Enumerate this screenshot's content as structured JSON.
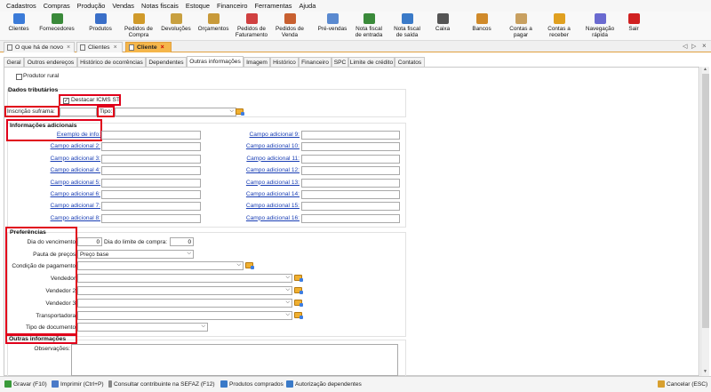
{
  "menu": [
    "Cadastros",
    "Compras",
    "Produção",
    "Vendas",
    "Notas fiscais",
    "Estoque",
    "Financeiro",
    "Ferramentas",
    "Ajuda"
  ],
  "toolbar": [
    {
      "label": "Clientes",
      "icon": "clientes-icon",
      "color": "#3b7bd8"
    },
    {
      "label": "Fornecedores",
      "icon": "fornecedores-icon",
      "color": "#3a8a3a"
    },
    {
      "label": "Produtos",
      "icon": "produtos-icon",
      "color": "#3a6fc8"
    },
    {
      "label": "Pedidos de\nCompra",
      "icon": "pedidos-compra-icon",
      "color": "#d09a2a"
    },
    {
      "label": "Devoluções",
      "icon": "devolucoes-icon",
      "color": "#c8a040"
    },
    {
      "label": "Orçamentos",
      "icon": "orcamentos-icon",
      "color": "#c89a3a"
    },
    {
      "label": "Pedidos de\nFaturamento",
      "icon": "pedidos-faturamento-icon",
      "color": "#d04040"
    },
    {
      "label": "Pedidos de\nVenda",
      "icon": "pedidos-venda-icon",
      "color": "#c86030"
    },
    {
      "label": "Pré-vendas",
      "icon": "pre-vendas-icon",
      "color": "#5a8ad0"
    },
    {
      "label": "Nota fiscal\nde entrada",
      "icon": "nota-entrada-icon",
      "color": "#3a8a3a"
    },
    {
      "label": "Nota fiscal\nde saída",
      "icon": "nota-saida-icon",
      "color": "#3a7ac8"
    },
    {
      "label": "Caixa",
      "icon": "caixa-icon",
      "color": "#555555"
    },
    {
      "label": "Bancos",
      "icon": "bancos-icon",
      "color": "#d08a2a"
    },
    {
      "label": "Contas a\npagar",
      "icon": "contas-pagar-icon",
      "color": "#c8a060"
    },
    {
      "label": "Contas a\nreceber",
      "icon": "contas-receber-icon",
      "color": "#e0a020"
    },
    {
      "label": "Navegação\nrápida",
      "icon": "navegacao-icon",
      "color": "#6a6ad0"
    },
    {
      "label": "Sair",
      "icon": "sair-icon",
      "color": "#d02020"
    }
  ],
  "doc_tabs": [
    {
      "label": "O que há de novo",
      "active": false
    },
    {
      "label": "Clientes",
      "active": false
    },
    {
      "label": "Cliente",
      "active": true
    }
  ],
  "sub_tabs": [
    "Geral",
    "Outros endereços",
    "Histórico de ocorrências",
    "Dependentes",
    "Outras informações",
    "Imagem",
    "Histórico",
    "Financeiro",
    "SPC",
    "Limite de crédito",
    "Contatos"
  ],
  "active_sub_tab": "Outras informações",
  "form": {
    "produtor_rural": "Produtor rural",
    "dados_tributarios": "Dados tributários",
    "destacar_icms": "Destacar ICMS ST",
    "inscricao_suframa": "Inscrição suframa:",
    "tipo": "Tipo:",
    "info_adicionais": "Informações adicionais",
    "campos_esq": [
      "Exemplo de info:",
      "Campo adicional 2:",
      "Campo adicional 3:",
      "Campo adicional 4:",
      "Campo adicional 5:",
      "Campo adicional 6:",
      "Campo adicional 7:",
      "Campo adicional 8:"
    ],
    "campos_dir": [
      "Campo adicional 9:",
      "Campo adicional 10:",
      "Campo adicional 11:",
      "Campo adicional 12:",
      "Campo adicional 13:",
      "Campo adicional 14:",
      "Campo adicional 15:",
      "Campo adicional 16:"
    ],
    "preferencias": "Preferências",
    "dia_vencimento": "Dia do vencimento:",
    "dia_vencimento_valor": "0",
    "dia_limite": "Dia do limite de compra:",
    "dia_limite_valor": "0",
    "pauta_precos": "Pauta de preços:",
    "pauta_precos_valor": "Preço base",
    "condicao_pagamento": "Condição de pagamento:",
    "vendedor": "Vendedor:",
    "vendedor2": "Vendedor 2:",
    "vendedor3": "Vendedor 3:",
    "transportadora": "Transportadora:",
    "tipo_documento": "Tipo de documento:",
    "outras_informacoes": "Outras informações",
    "observacoes": "Observações:"
  },
  "bottom": {
    "gravar": "Gravar (F10)",
    "imprimir": "Imprimir (Ctrl+P)",
    "consultar": "Consultar contribuinte na SEFAZ (F12)",
    "produtos": "Produtos comprados",
    "autorizacao": "Autorização dependentes",
    "cancelar": "Cancelar (ESC)"
  }
}
